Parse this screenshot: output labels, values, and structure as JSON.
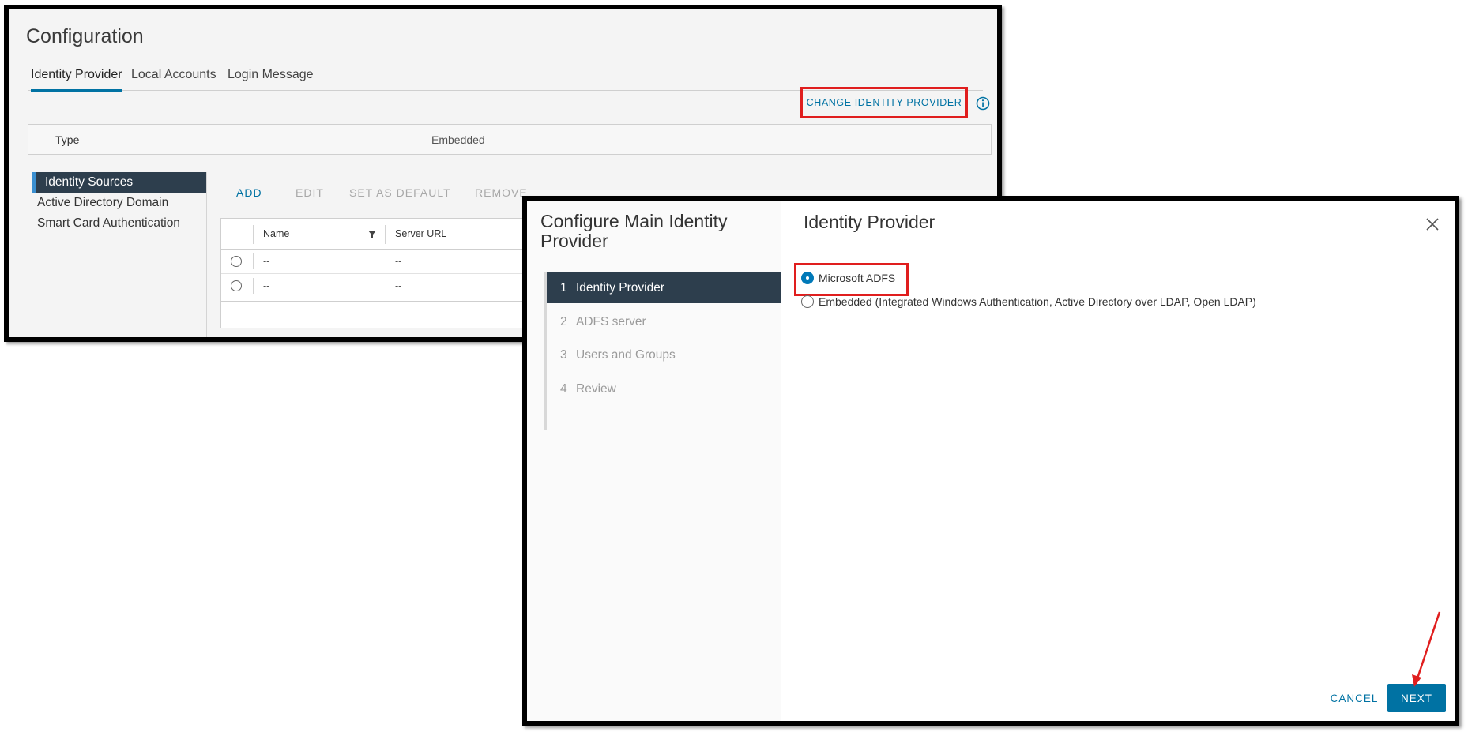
{
  "config": {
    "title": "Configuration",
    "tabs": [
      {
        "label": "Identity Provider",
        "active": true
      },
      {
        "label": "Local Accounts",
        "active": false
      },
      {
        "label": "Login Message",
        "active": false
      }
    ],
    "change_button": "CHANGE IDENTITY PROVIDER",
    "type_label": "Type",
    "type_value": "Embedded",
    "side_nav": [
      {
        "label": "Identity Sources",
        "active": true
      },
      {
        "label": "Active Directory Domain",
        "active": false
      },
      {
        "label": "Smart Card Authentication",
        "active": false
      }
    ],
    "actions": [
      {
        "label": "ADD",
        "enabled": true
      },
      {
        "label": "EDIT",
        "enabled": false
      },
      {
        "label": "SET AS DEFAULT",
        "enabled": false
      },
      {
        "label": "REMOVE",
        "enabled": false
      }
    ],
    "grid": {
      "columns": [
        "Name",
        "Server URL"
      ],
      "rows": [
        [
          "--",
          "--"
        ],
        [
          "--",
          "--"
        ]
      ]
    }
  },
  "dialog": {
    "title": "Configure Main Identity Provider",
    "steps": [
      {
        "num": "1",
        "label": "Identity Provider",
        "active": true
      },
      {
        "num": "2",
        "label": "ADFS server",
        "active": false
      },
      {
        "num": "3",
        "label": "Users and Groups",
        "active": false
      },
      {
        "num": "4",
        "label": "Review",
        "active": false
      }
    ],
    "panel_title": "Identity Provider",
    "options": [
      {
        "label": "Microsoft ADFS",
        "selected": true
      },
      {
        "label": "Embedded (Integrated Windows Authentication, Active Directory over LDAP, Open LDAP)",
        "selected": false
      }
    ],
    "cancel_label": "CANCEL",
    "next_label": "NEXT"
  },
  "colors": {
    "accent": "#0072a3",
    "highlight_box": "#e01e1e",
    "nav_active_bg": "#2d3e4d"
  },
  "icons": [
    "info-icon",
    "filter-icon",
    "close-icon",
    "arrow-annotation"
  ]
}
